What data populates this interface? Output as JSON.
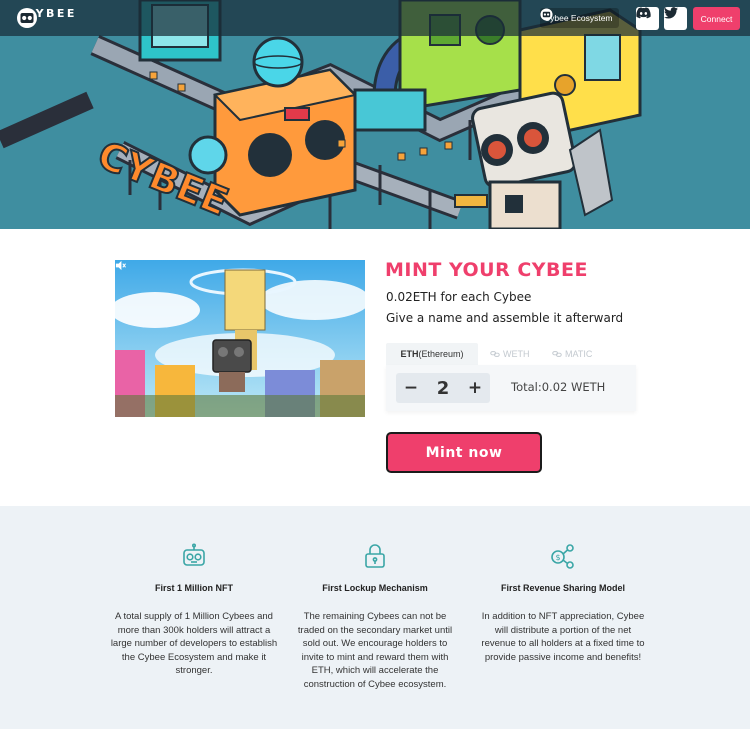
{
  "header": {
    "logo_text": "CYBEE",
    "ecosystem_label": "Cybee Ecosystem",
    "connect_label": "Connect",
    "icons": [
      "cybee-logo-icon",
      "cybee-ecosystem-icon",
      "discord-icon",
      "twitter-icon"
    ]
  },
  "mint": {
    "title": "MINT YOUR CYBEE",
    "price_line": "0.02ETH for each Cybee",
    "info_line": "Give a name and assemble it afterward",
    "tabs": [
      {
        "label": "ETH",
        "sub": "(Ethereum)",
        "active": true
      },
      {
        "label": "WETH",
        "active": false
      },
      {
        "label": "MATIC",
        "active": false
      }
    ],
    "quantity": "2",
    "minus_label": "−",
    "plus_label": "+",
    "total": "Total:0.02 WETH",
    "button_label": "Mint now"
  },
  "features": [
    {
      "title": "First 1 Million NFT",
      "text": "A total supply of 1 Million Cybees and more than 300k holders will attract a large number of developers to establish the Cybee Ecosystem and make it stronger.",
      "icon": "robot-face-icon"
    },
    {
      "title": "First Lockup Mechanism",
      "text": "The remaining Cybees can not be traded on the secondary market until sold out. We encourage holders to invite to mint and reward them with ETH, which will accelerate the construction of Cybee ecosystem.",
      "icon": "lock-icon"
    },
    {
      "title": "First Revenue Sharing Model",
      "text": "In addition to NFT appreciation, Cybee will distribute a portion of the net revenue to all holders at a fixed time to provide passive income and benefits!",
      "icon": "revenue-share-icon"
    }
  ],
  "colors": {
    "accent": "#ef3f6c",
    "hero_bg": "#3f8ea0",
    "feature_bg": "#edf2f6",
    "feature_icon": "#3aa6a6"
  }
}
